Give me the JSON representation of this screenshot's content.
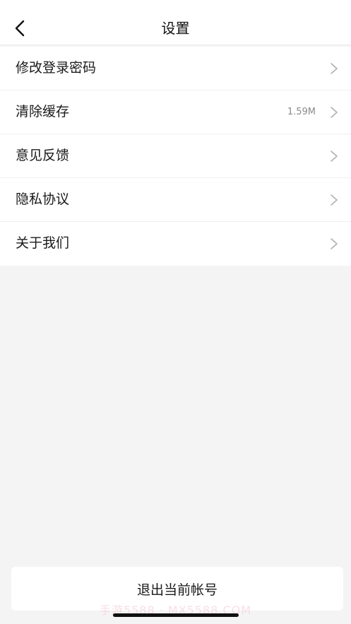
{
  "header": {
    "title": "设置",
    "back_icon": "chevron-left-icon"
  },
  "settings": {
    "items": [
      {
        "label": "修改登录密码",
        "value": ""
      },
      {
        "label": "清除缓存",
        "value": "1.59M"
      },
      {
        "label": "意见反馈",
        "value": ""
      },
      {
        "label": "隐私协议",
        "value": ""
      },
      {
        "label": "关于我们",
        "value": ""
      }
    ],
    "row_icon": "chevron-right-icon"
  },
  "footer": {
    "logout_label": "退出当前帐号"
  },
  "watermark": {
    "text": "手游5588 · MX5588.COM"
  },
  "colors": {
    "background": "#f4f4f4",
    "card": "#ffffff",
    "text": "#1a1a1a",
    "secondary_text": "#8a8a8a",
    "chevron": "#b0b0b0"
  }
}
